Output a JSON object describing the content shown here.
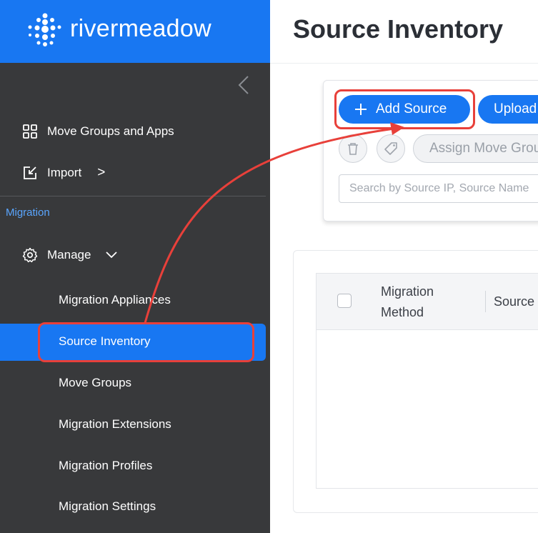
{
  "brand": {
    "name": "rivermeadow"
  },
  "sidebar": {
    "items": [
      {
        "label": "Move Groups and Apps",
        "icon": "grid-icon"
      },
      {
        "label": "Import",
        "icon": "import-icon",
        "chevron": ">"
      }
    ],
    "section": "Migration",
    "manage": {
      "label": "Manage",
      "icon": "gear-icon"
    },
    "subitems": [
      "Migration Appliances",
      "Source Inventory",
      "Move Groups",
      "Migration Extensions",
      "Migration Profiles",
      "Migration Settings"
    ],
    "active": "Source Inventory"
  },
  "main": {
    "title": "Source Inventory",
    "toolbar": {
      "add_source": "Add Source",
      "upload": "Upload",
      "assign_move_group": "Assign Move Group"
    },
    "search": {
      "placeholder": "Search by Source IP, Source Name"
    },
    "table": {
      "columns": [
        "Migration Method",
        "Source"
      ]
    }
  },
  "colors": {
    "accent": "#1877f2",
    "sidebar": "#38393b",
    "highlight": "#e8403a",
    "section_label": "#5aa6ff"
  }
}
